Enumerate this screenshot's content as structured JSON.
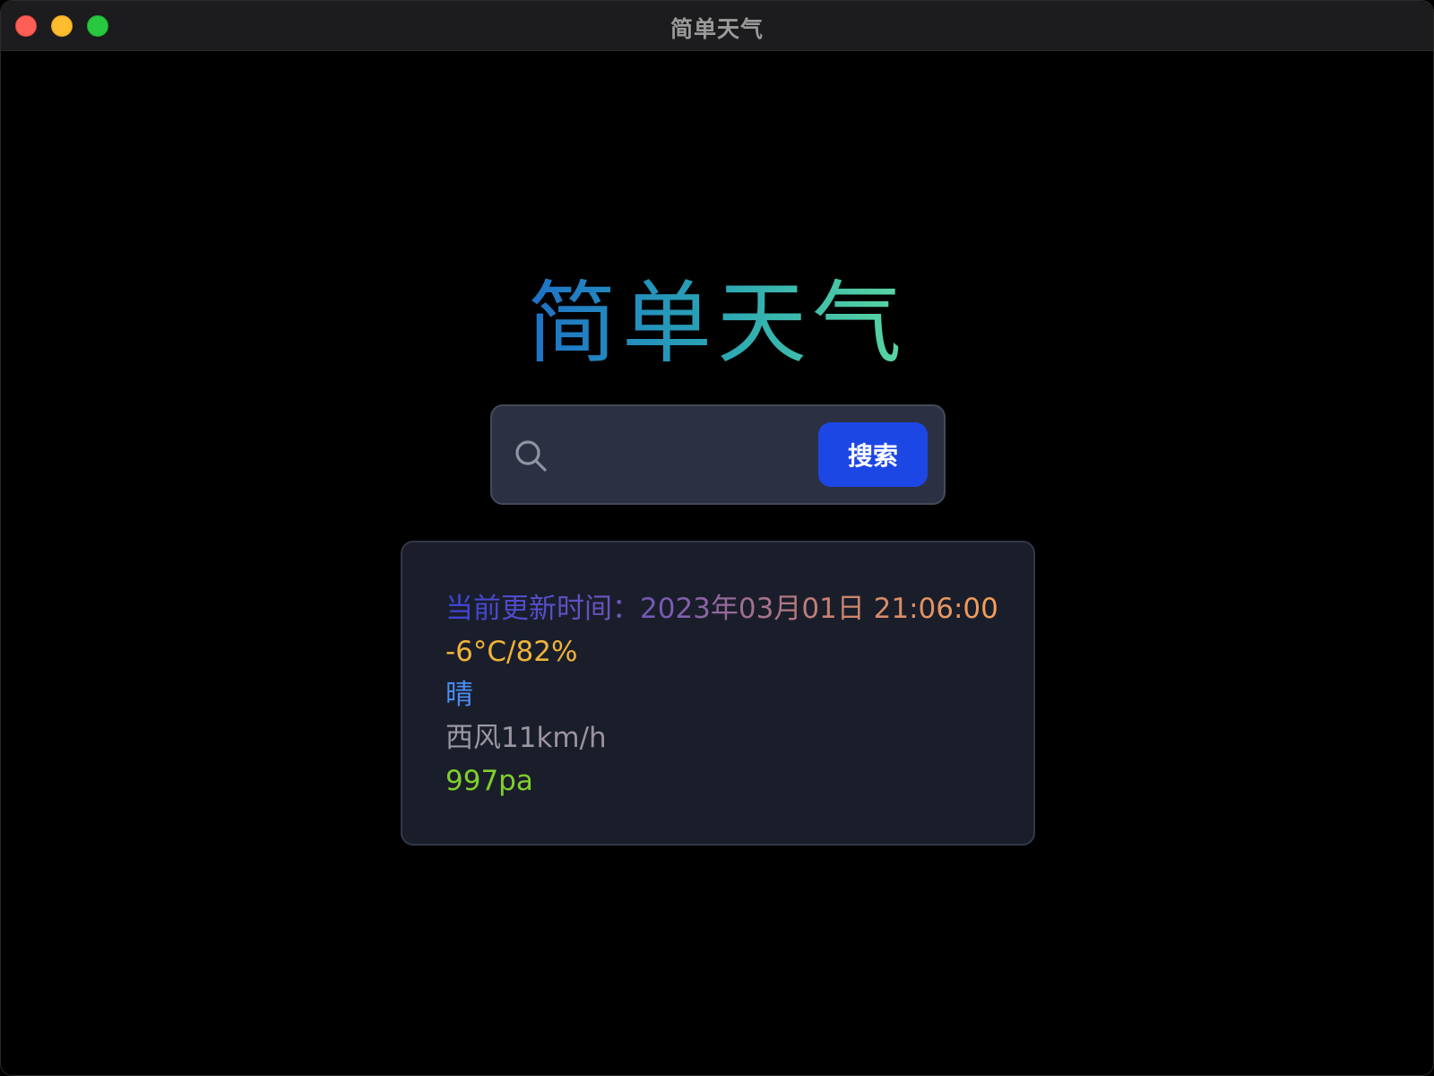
{
  "window": {
    "title": "简单天气"
  },
  "app": {
    "title": "简单天气"
  },
  "search": {
    "value": "",
    "placeholder": "",
    "button_label": "搜索",
    "button_color": "#1d47e5"
  },
  "weather": {
    "update_time": "当前更新时间：2023年03月01日 21:06:00",
    "temp_humidity": "-6°C/82%",
    "condition": "晴",
    "wind": "西风11km/h",
    "pressure": "997pa"
  },
  "colors": {
    "background": "#000000",
    "card": "#1a1e2b",
    "search_box": "#2b3142",
    "temp": "#f0b339",
    "condition": "#4b8ef5",
    "pressure": "#7fd02b"
  },
  "icons": {
    "search": "search-icon"
  }
}
